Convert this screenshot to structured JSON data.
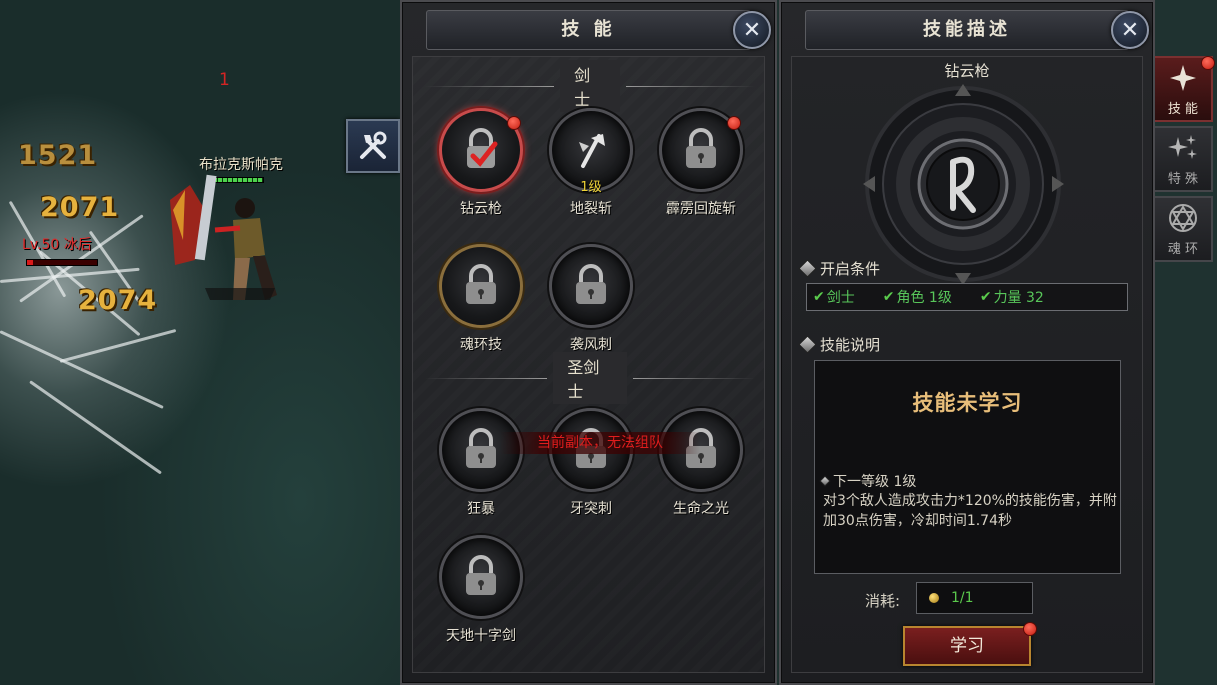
{
  "scene": {
    "damage_numbers": [
      "1521",
      "2071",
      "2074"
    ],
    "red_marker": "1",
    "enemy_label": "Lv.50 冰后",
    "enemy_hp_fraction": 0.08,
    "player_name": "布拉克斯帕克",
    "player_hp_fraction": 1.0,
    "tool_button_icon": "tools-icon"
  },
  "skills_panel": {
    "title": "技 能",
    "close_icon": "close-icon",
    "sections": [
      {
        "title": "剑士",
        "skills": [
          {
            "name": "钻云枪",
            "level": "",
            "state": "selected",
            "badge": true
          },
          {
            "name": "地裂斩",
            "level": "1级",
            "state": "learned",
            "badge": false
          },
          {
            "name": "霹雳回旋斩",
            "level": "",
            "state": "locked",
            "badge": true
          },
          {
            "name": "魂环技",
            "level": "",
            "state": "locked-gold",
            "badge": false
          },
          {
            "name": "袭风刺",
            "level": "",
            "state": "locked",
            "badge": false
          }
        ]
      },
      {
        "title": "圣剑士",
        "skills": [
          {
            "name": "狂暴",
            "level": "",
            "state": "locked",
            "badge": false
          },
          {
            "name": "牙突刺",
            "level": "",
            "state": "locked",
            "badge": false
          },
          {
            "name": "生命之光",
            "level": "",
            "state": "locked",
            "badge": false
          },
          {
            "name": "天地十字剑",
            "level": "",
            "state": "locked",
            "badge": false
          }
        ]
      }
    ],
    "notice": "当前副本，无法组队"
  },
  "desc_panel": {
    "title": "技能描述",
    "skill_name": "钻云枪",
    "conditions_label": "开启条件",
    "conditions": [
      "剑士",
      "角色 1级",
      "力量 32"
    ],
    "desc_label": "技能说明",
    "status": "技能未学习",
    "next_level": "下一等级 1级",
    "description": "对3个敌人造成攻击力*120%的技能伤害，并附加30点伤害，冷却时间1.74秒",
    "cost_label": "消耗:",
    "cost_value": "1/1",
    "learn_button": "学习"
  },
  "side_tabs": [
    {
      "label": "技 能",
      "icon": "skill-star-icon",
      "active": true,
      "badge": true
    },
    {
      "label": "特 殊",
      "icon": "special-sparkle-icon",
      "active": false,
      "badge": false
    },
    {
      "label": "魂 环",
      "icon": "hexagram-icon",
      "active": false,
      "badge": false
    }
  ]
}
